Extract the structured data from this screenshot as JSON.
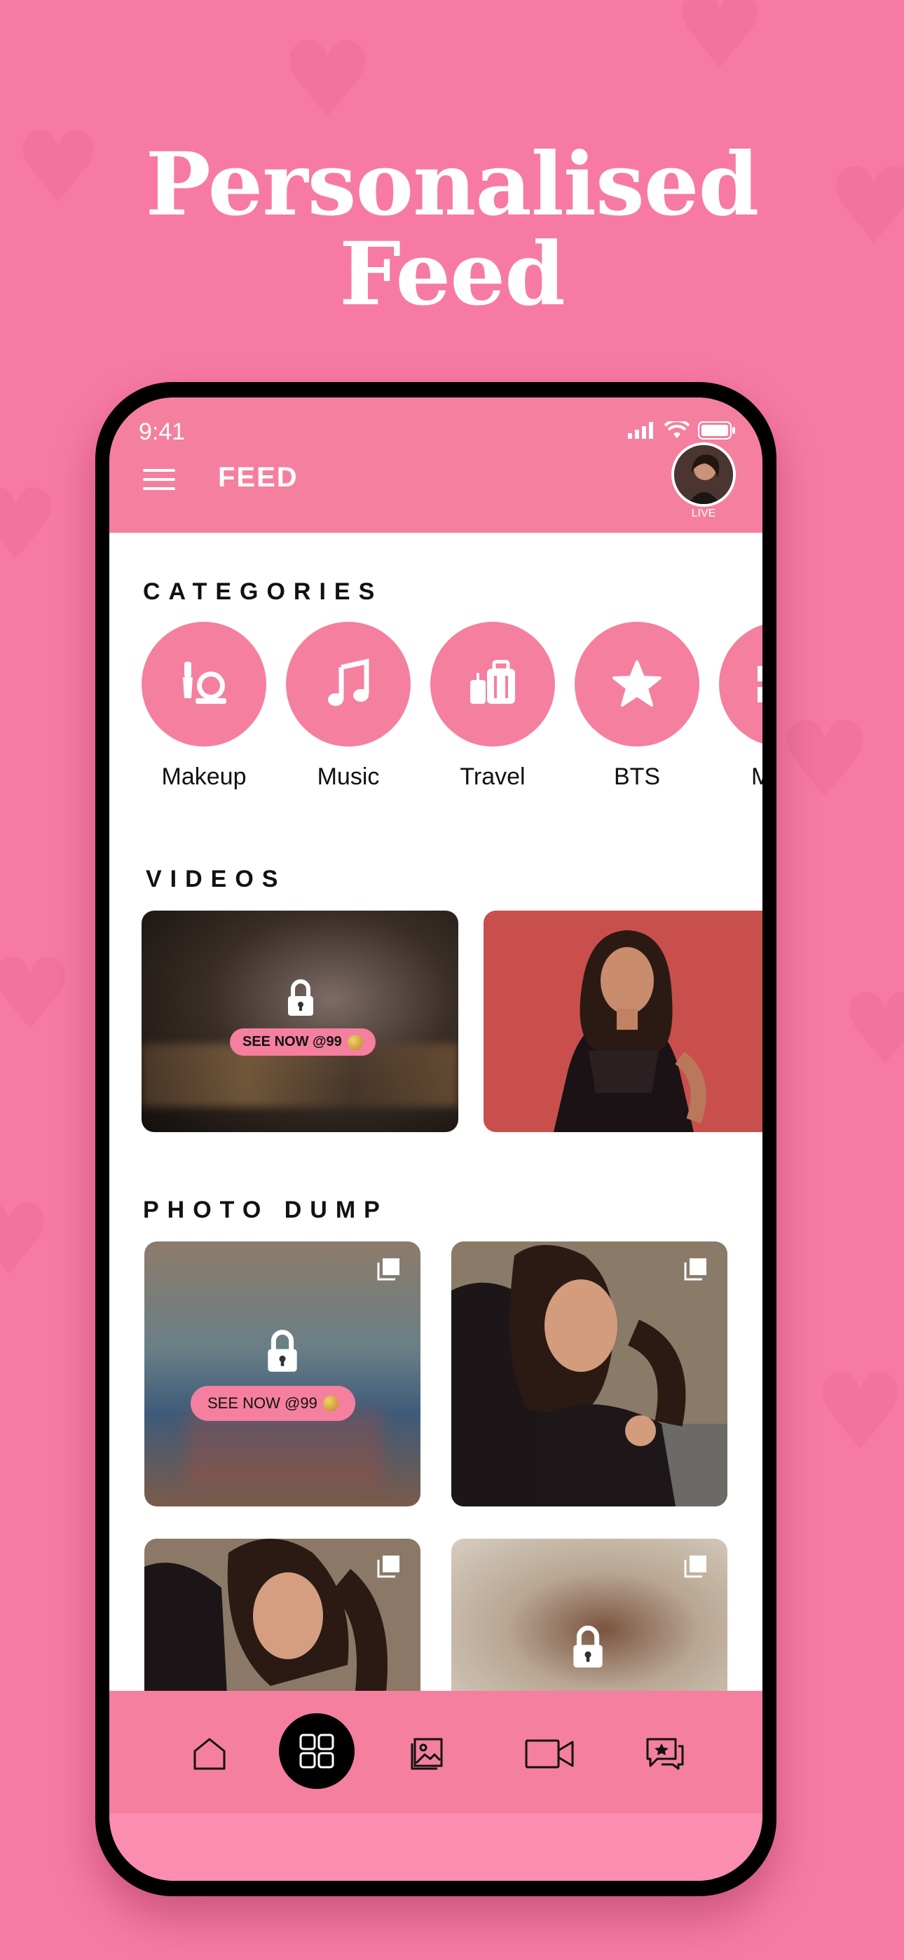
{
  "headline": {
    "line1": "Personalised",
    "line2": "Feed"
  },
  "status_bar": {
    "time": "9:41"
  },
  "appbar": {
    "title": "FEED",
    "avatar_badge": "LIVE"
  },
  "categories": {
    "title": "CATEGORIES",
    "items": [
      {
        "label": "Makeup",
        "icon": "makeup-icon"
      },
      {
        "label": "Music",
        "icon": "music-note-icon"
      },
      {
        "label": "Travel",
        "icon": "luggage-icon"
      },
      {
        "label": "BTS",
        "icon": "star-icon"
      },
      {
        "label": "M",
        "icon": "partial-icon"
      }
    ]
  },
  "videos": {
    "title": "VIDEOS",
    "items": [
      {
        "locked": true,
        "cta": "SEE NOW @99"
      },
      {
        "locked": false
      }
    ]
  },
  "photo_dump": {
    "title": "PHOTO DUMP",
    "items": [
      {
        "locked": true,
        "cta": "SEE NOW @99"
      },
      {
        "locked": false
      },
      {
        "locked": false
      },
      {
        "locked": true
      }
    ]
  },
  "bottom_nav": {
    "items": [
      "home-icon",
      "grid-icon",
      "gallery-icon",
      "video-camera-icon",
      "chat-star-icon"
    ],
    "active": "grid-icon"
  },
  "colors": {
    "brand_pink": "#f57f9f",
    "background": "#f77aa4",
    "text": "#111111"
  }
}
